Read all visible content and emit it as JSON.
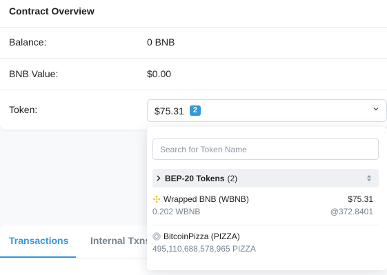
{
  "overview": {
    "title": "Contract Overview",
    "balance_label": "Balance:",
    "balance_value": "0 BNB",
    "bnb_value_label": "BNB Value:",
    "bnb_value_value": "$0.00",
    "token_label": "Token:"
  },
  "token_select": {
    "value": "$75.31",
    "count_badge": "2",
    "icon": "chevron-down-icon"
  },
  "dropdown": {
    "search_placeholder": "Search for Token Name",
    "group": {
      "title": "BEP-20 Tokens",
      "count": "(2)"
    },
    "tokens": [
      {
        "name": "Wrapped BNB (WBNB)",
        "amount": "0.202 WBNB",
        "price": "$75.31",
        "rate": "@372.8401",
        "icon": "bnb-token-icon"
      },
      {
        "name": "BitcoinPizza (PIZZA)",
        "amount": "495,110,688,578,965 PIZZA",
        "icon": "generic-token-icon"
      }
    ]
  },
  "tabs": [
    {
      "label": "Transactions",
      "active": true
    },
    {
      "label": "Internal Txns",
      "active": false
    }
  ],
  "colors": {
    "accent": "#3498db",
    "bnb_yellow": "#f0b90b"
  }
}
